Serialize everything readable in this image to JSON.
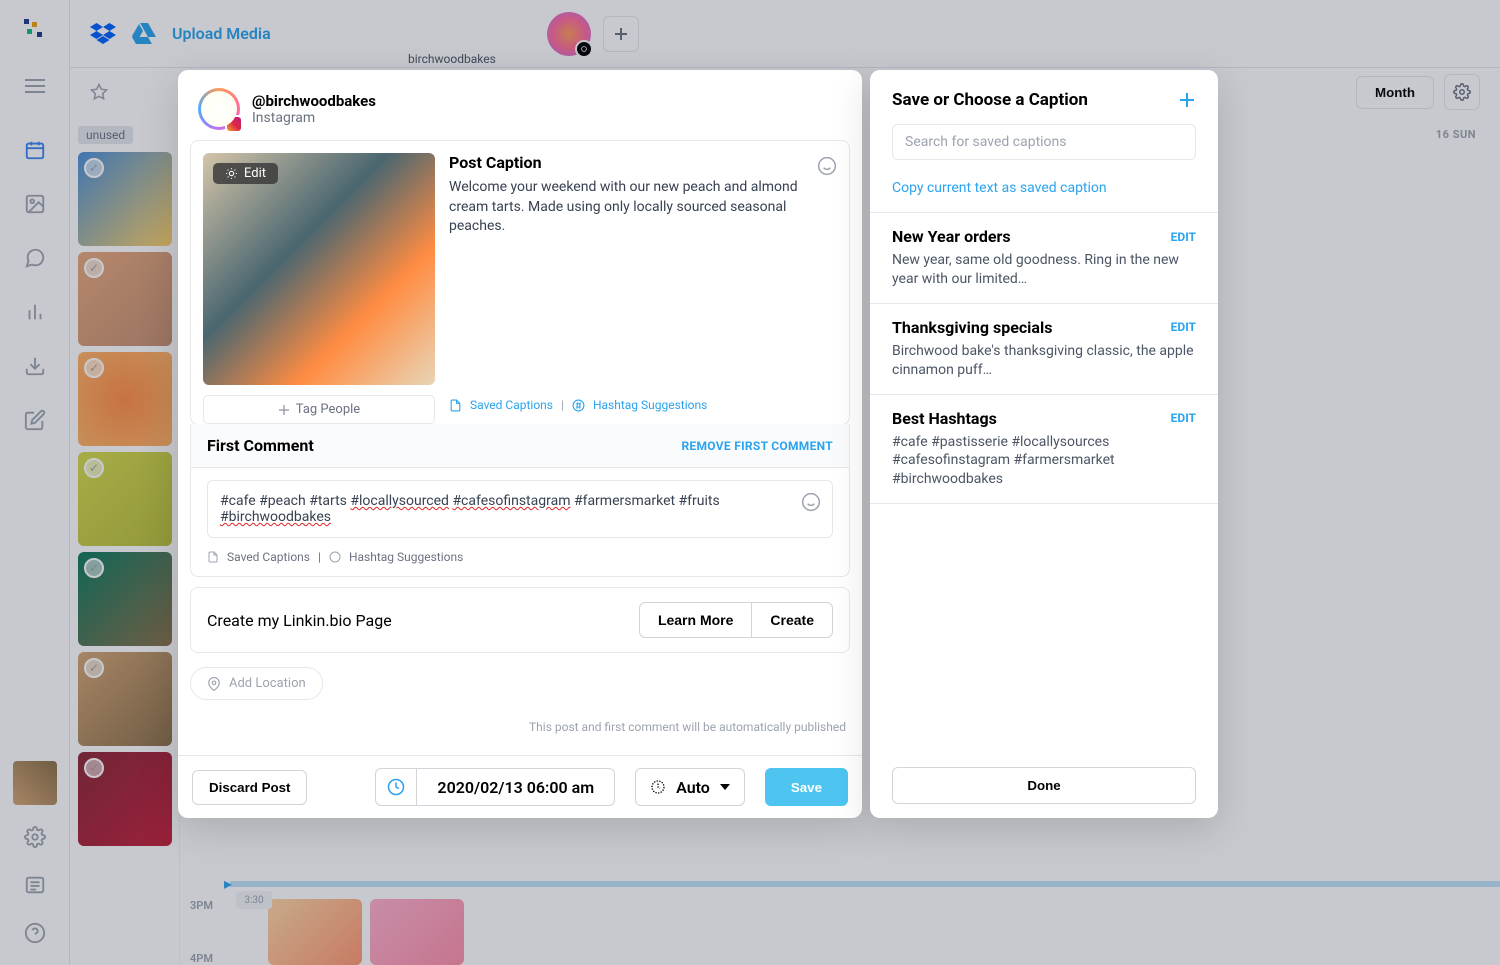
{
  "rail": {
    "nav": [
      "calendar",
      "media",
      "comments",
      "analytics",
      "downloads",
      "edit"
    ]
  },
  "topbar": {
    "upload_label": "Upload Media",
    "account_name": "birchwoodbakes"
  },
  "subbar": {
    "unused_tag": "unused",
    "month_label": "Month",
    "day_label": "16 SUN"
  },
  "timeline": {
    "labels": [
      "3PM",
      "4PM"
    ],
    "small": "3:30"
  },
  "modal": {
    "handle": "@birchwoodbakes",
    "platform": "Instagram",
    "edit_label": "Edit",
    "caption_label": "Post Caption",
    "caption_text": "Welcome your weekend with our new peach and almond cream tarts. Made using only locally sourced seasonal peaches.",
    "tag_people": "Tag People",
    "saved_captions": "Saved Captions",
    "hashtag_suggestions": "Hashtag Suggestions",
    "first_comment_title": "First Comment",
    "remove_first_comment": "REMOVE FIRST COMMENT",
    "first_comment_prefix": "#cafe #peach #tarts ",
    "first_comment_sq1": "#locallysourced",
    "first_comment_mid": " ",
    "first_comment_sq2": "#cafesofinstagram",
    "first_comment_suffix": " #farmersmarket #fruits ",
    "first_comment_sq3": "#birchwoodbakes",
    "linkin_label": "Create my Linkin.bio Page",
    "learn_more": "Learn More",
    "create": "Create",
    "add_location": "Add Location",
    "auto_pub_note": "This post and first comment will be automatically published",
    "discard": "Discard Post",
    "date": "2020/02/13 06:00 am",
    "auto_label": "Auto",
    "save": "Save"
  },
  "panel": {
    "title": "Save or Choose a Caption",
    "search_placeholder": "Search for saved captions",
    "copy_link": "Copy current text as saved caption",
    "edit_label": "EDIT",
    "done": "Done",
    "captions": [
      {
        "name": "New Year orders",
        "text": "New year, same old goodness. Ring in the new year with our limited…"
      },
      {
        "name": "Thanksgiving specials",
        "text": "Birchwood bake's thanksgiving classic, the apple cinnamon puff…"
      },
      {
        "name": "Best Hashtags",
        "text": "#cafe #pastisserie #locallysources #cafesofinstagram #farmersmarket #birchwoodbakes"
      }
    ]
  }
}
